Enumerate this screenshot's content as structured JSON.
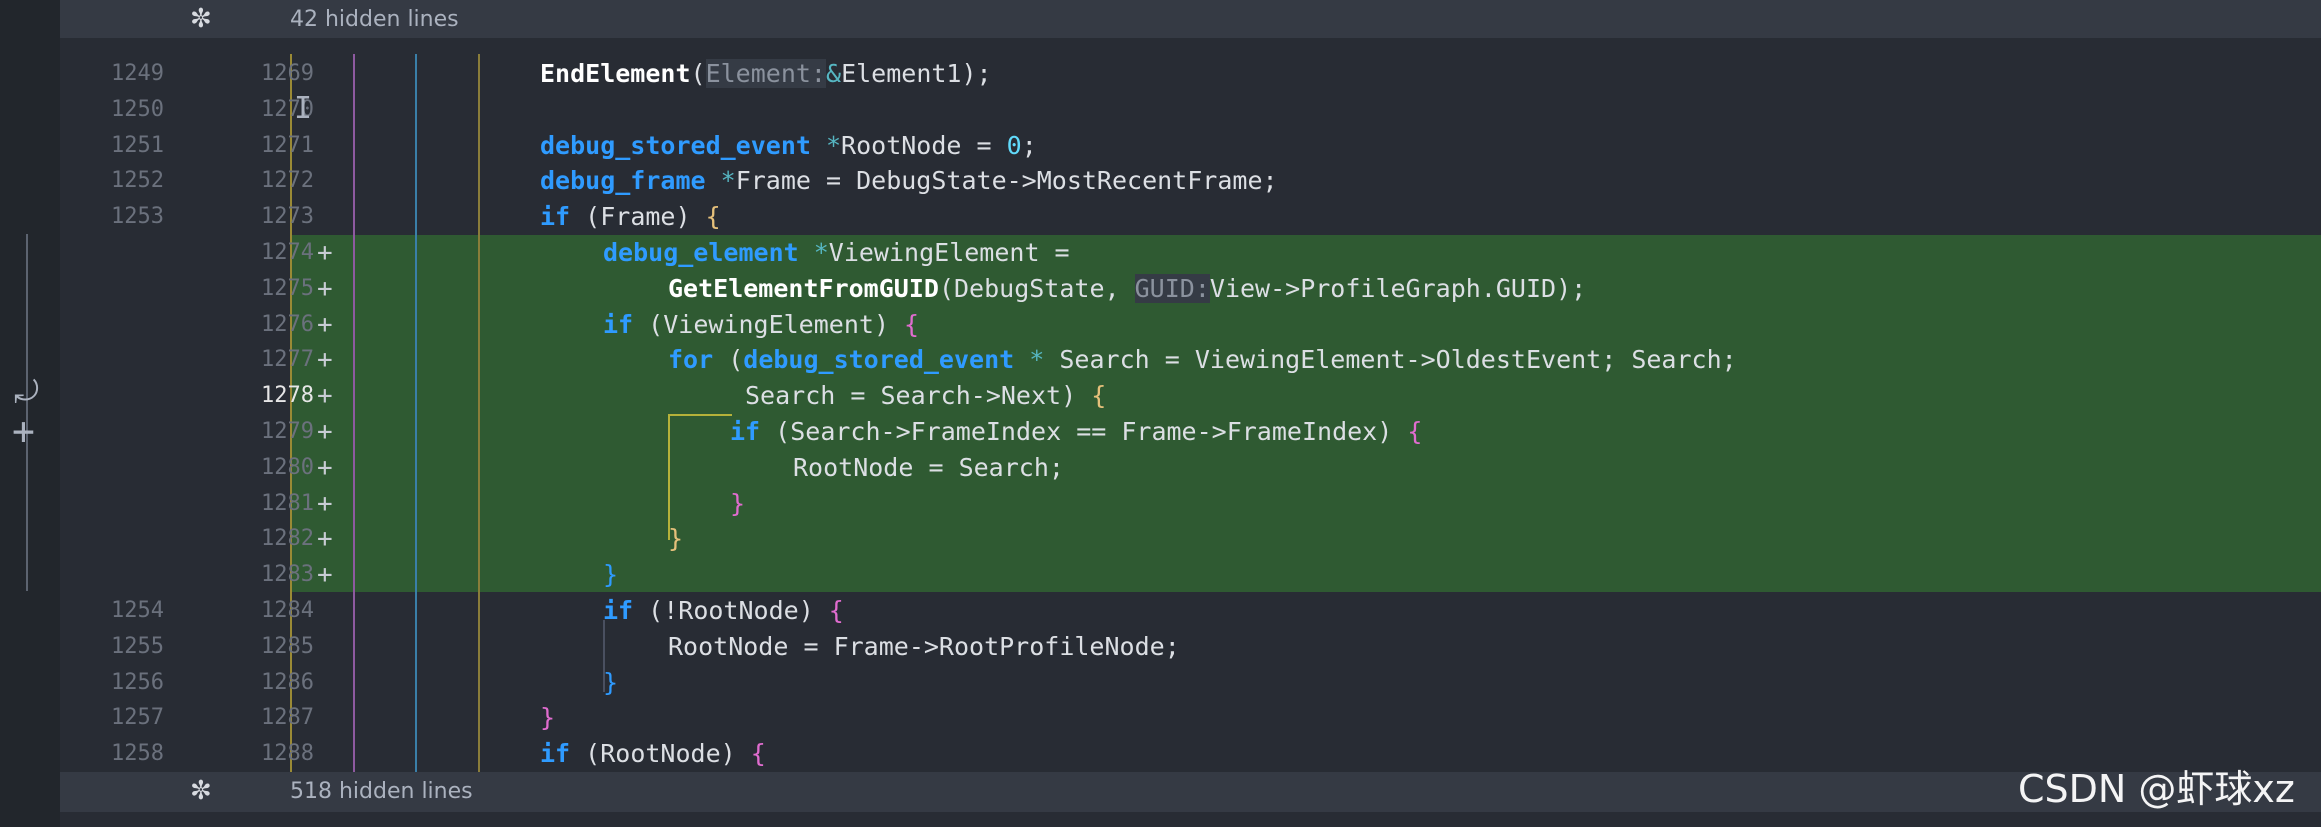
{
  "folds": {
    "top": "42 hidden lines",
    "bottom": "518 hidden lines"
  },
  "lines": [
    {
      "old": "1249",
      "new": "1269",
      "marker": "",
      "active": false,
      "added": false
    },
    {
      "old": "1250",
      "new": "1270",
      "marker": "",
      "active": false,
      "added": false
    },
    {
      "old": "1251",
      "new": "1271",
      "marker": "",
      "active": false,
      "added": false
    },
    {
      "old": "1252",
      "new": "1272",
      "marker": "",
      "active": false,
      "added": false
    },
    {
      "old": "1253",
      "new": "1273",
      "marker": "",
      "active": false,
      "added": false
    },
    {
      "old": "",
      "new": "1274",
      "marker": "+",
      "active": false,
      "added": true
    },
    {
      "old": "",
      "new": "1275",
      "marker": "+",
      "active": false,
      "added": true
    },
    {
      "old": "",
      "new": "1276",
      "marker": "+",
      "active": false,
      "added": true
    },
    {
      "old": "",
      "new": "1277",
      "marker": "+",
      "active": false,
      "added": true
    },
    {
      "old": "",
      "new": "1278",
      "marker": "+",
      "active": true,
      "added": true
    },
    {
      "old": "",
      "new": "1279",
      "marker": "+",
      "active": false,
      "added": true
    },
    {
      "old": "",
      "new": "1280",
      "marker": "+",
      "active": false,
      "added": true
    },
    {
      "old": "",
      "new": "1281",
      "marker": "+",
      "active": false,
      "added": true
    },
    {
      "old": "",
      "new": "1282",
      "marker": "+",
      "active": false,
      "added": true
    },
    {
      "old": "",
      "new": "1283",
      "marker": "+",
      "active": false,
      "added": true
    },
    {
      "old": "1254",
      "new": "1284",
      "marker": "",
      "active": false,
      "added": false
    },
    {
      "old": "1255",
      "new": "1285",
      "marker": "",
      "active": false,
      "added": false
    },
    {
      "old": "1256",
      "new": "1286",
      "marker": "",
      "active": false,
      "added": false
    },
    {
      "old": "1257",
      "new": "1287",
      "marker": "",
      "active": false,
      "added": false
    },
    {
      "old": "1258",
      "new": "1288",
      "marker": "",
      "active": false,
      "added": false
    }
  ],
  "code": {
    "l1269": {
      "fn": "EndElement",
      "p1": "(",
      "hint": "Element:",
      "amp": "&",
      "arg": "Element1",
      "p2": ");"
    },
    "l1271": {
      "type": "debug_stored_event",
      "ptr": " *",
      "name": "RootNode",
      "eq": " = ",
      "val": "0",
      "end": ";"
    },
    "l1272": {
      "type": "debug_frame",
      "ptr": " *",
      "name": "Frame",
      "rest": " = DebugState->MostRecentFrame;"
    },
    "l1273": {
      "kw": "if",
      "open": " (",
      "cond": "Frame",
      "close": ") ",
      "brace": "{"
    },
    "l1274": {
      "type": "debug_element",
      "ptr": " *",
      "name": "ViewingElement",
      "eq": " ="
    },
    "l1275": {
      "fn": "GetElementFromGUID",
      "p1": "(",
      "a1": "DebugState, ",
      "hint": "GUID:",
      "a2": "View->ProfileGraph.GUID",
      "p2": ");"
    },
    "l1276": {
      "kw": "if",
      "open": " (",
      "cond": "ViewingElement",
      "close": ") ",
      "brace": "{"
    },
    "l1277": {
      "kw": "for",
      "open": " (",
      "type": "debug_stored_event",
      "ptr": " *",
      "rest": "Search = ViewingElement->OldestEvent; Search;"
    },
    "l1278": {
      "rest": "Search = Search->Next",
      "close": ") ",
      "brace": "{"
    },
    "l1279": {
      "kw": "if",
      "open": " (",
      "cond": "Search->FrameIndex == Frame->FrameIndex",
      "close": ") ",
      "brace": "{"
    },
    "l1280": {
      "rest": "RootNode = Search;"
    },
    "l1281": {
      "brace": "}"
    },
    "l1282": {
      "brace": "}"
    },
    "l1283": {
      "brace": "}"
    },
    "l1284": {
      "kw": "if",
      "open": " (",
      "cond": "!RootNode",
      "close": ") ",
      "brace": "{"
    },
    "l1285": {
      "rest": "RootNode = Frame->RootProfileNode;"
    },
    "l1286": {
      "brace": "}"
    },
    "l1287": {
      "brace": "}"
    },
    "l1288": {
      "kw": "if",
      "open": " (",
      "cond": "RootNode",
      "close": ") ",
      "brace": "{"
    }
  },
  "watermark": "CSDN @虾球xz",
  "icons": {
    "fold": "snowflake-icon",
    "revert": "undo-icon",
    "add": "plus-icon",
    "cursor": "ibeam-cursor-icon"
  }
}
